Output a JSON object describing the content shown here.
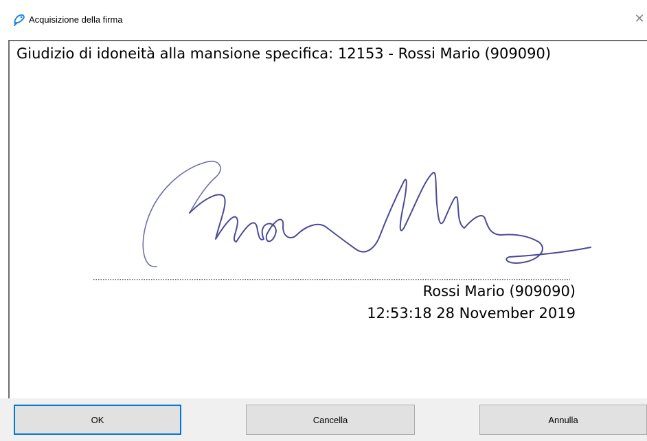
{
  "window": {
    "title": "Acquisizione della firma",
    "title_icon": "pen-icon",
    "close_icon": "close-icon",
    "close_glyph": "✕"
  },
  "signature_pad": {
    "header": "Giudizio di idoneità alla mansione specifica: 12153 - Rossi Mario (909090)",
    "signer": "Rossi Mario (909090)",
    "timestamp": "12:53:18 28 November 2019",
    "ink_color": "#4a4a96"
  },
  "buttons": {
    "ok": "OK",
    "cancella": "Cancella",
    "annulla": "Annulla"
  },
  "colors": {
    "focus_border": "#0078d7",
    "button_bg": "#e1e1e1",
    "bar_bg": "#f0f0f0"
  }
}
